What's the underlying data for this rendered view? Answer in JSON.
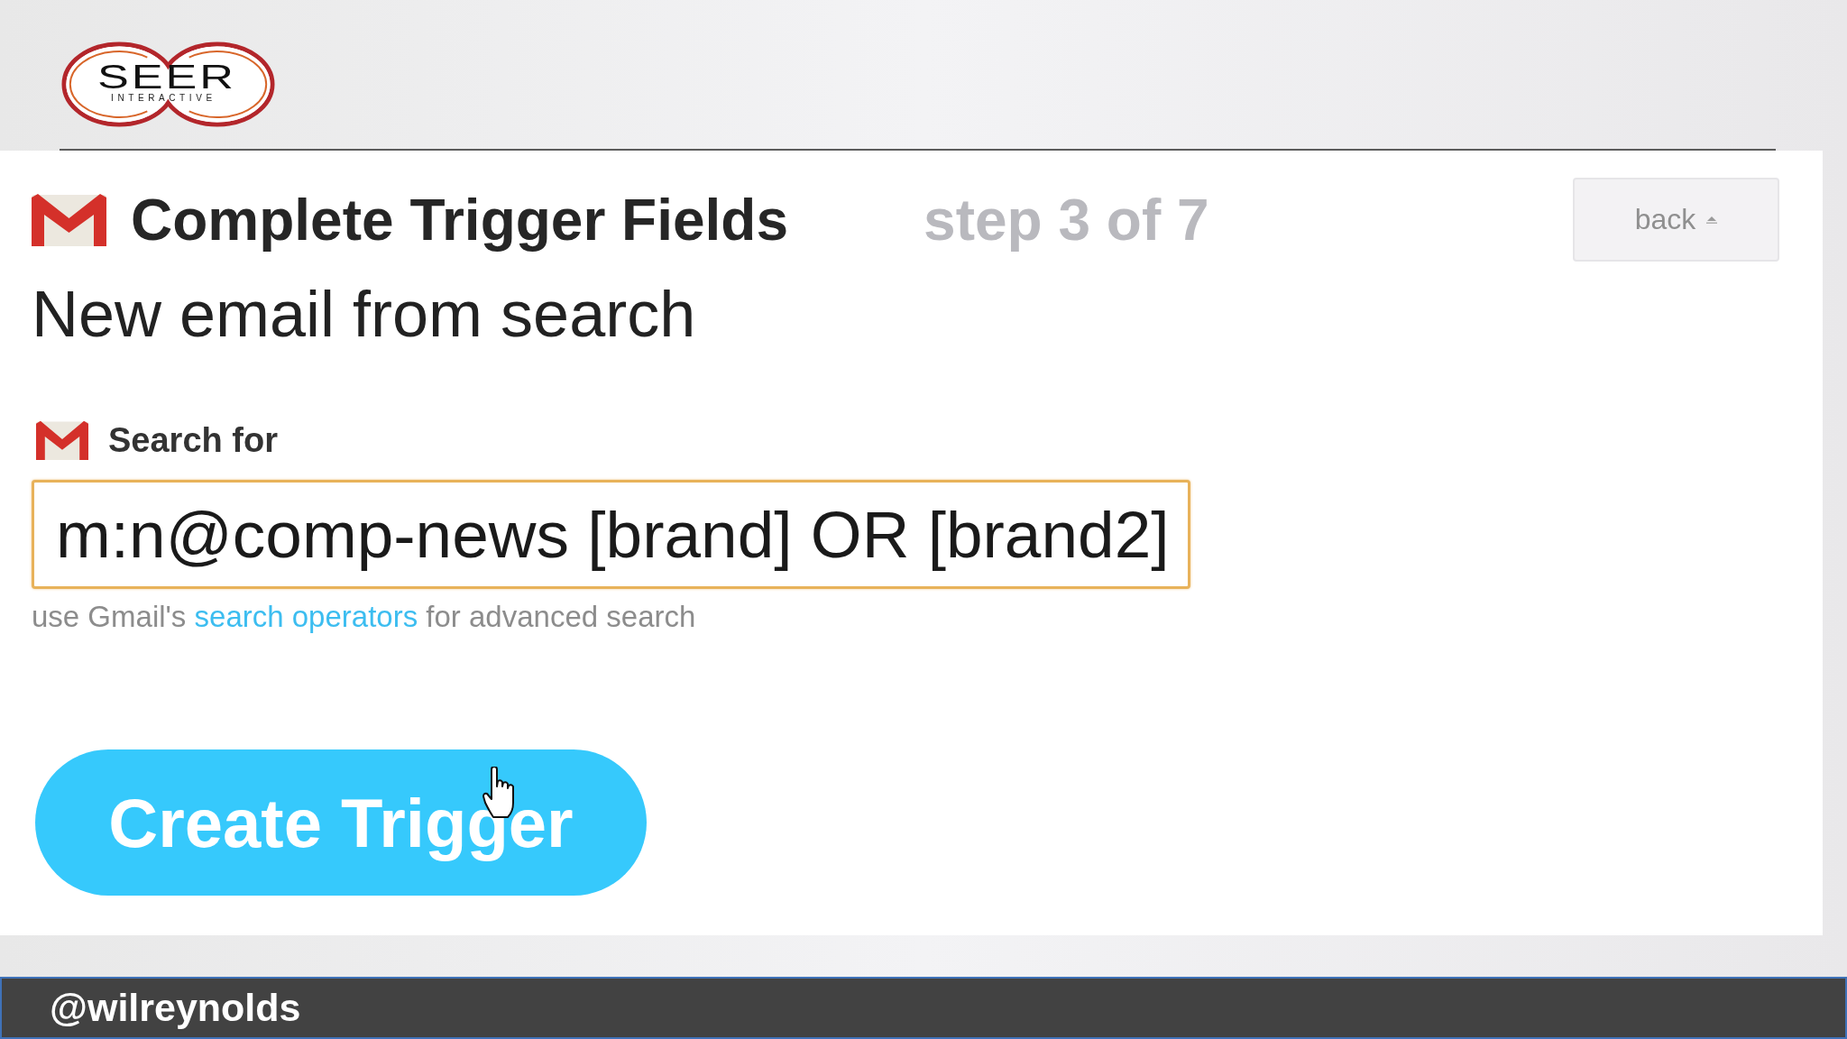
{
  "header": {
    "logo": {
      "wordmark": "SEER",
      "tagline": "INTERACTIVE"
    }
  },
  "panel": {
    "title": "Complete Trigger Fields",
    "step": "step 3 of 7",
    "back_button": "back",
    "trigger_name": "New email from search",
    "field": {
      "label": "Search for",
      "value": "m:n@comp-news [brand] OR [brand2]",
      "focused": true,
      "hint": {
        "before": "use Gmail's",
        "link": "search operators",
        "after": "for advanced search"
      }
    },
    "submit_button": "Create Trigger"
  },
  "caption_bar": {
    "text": "@wilreynolds"
  }
}
